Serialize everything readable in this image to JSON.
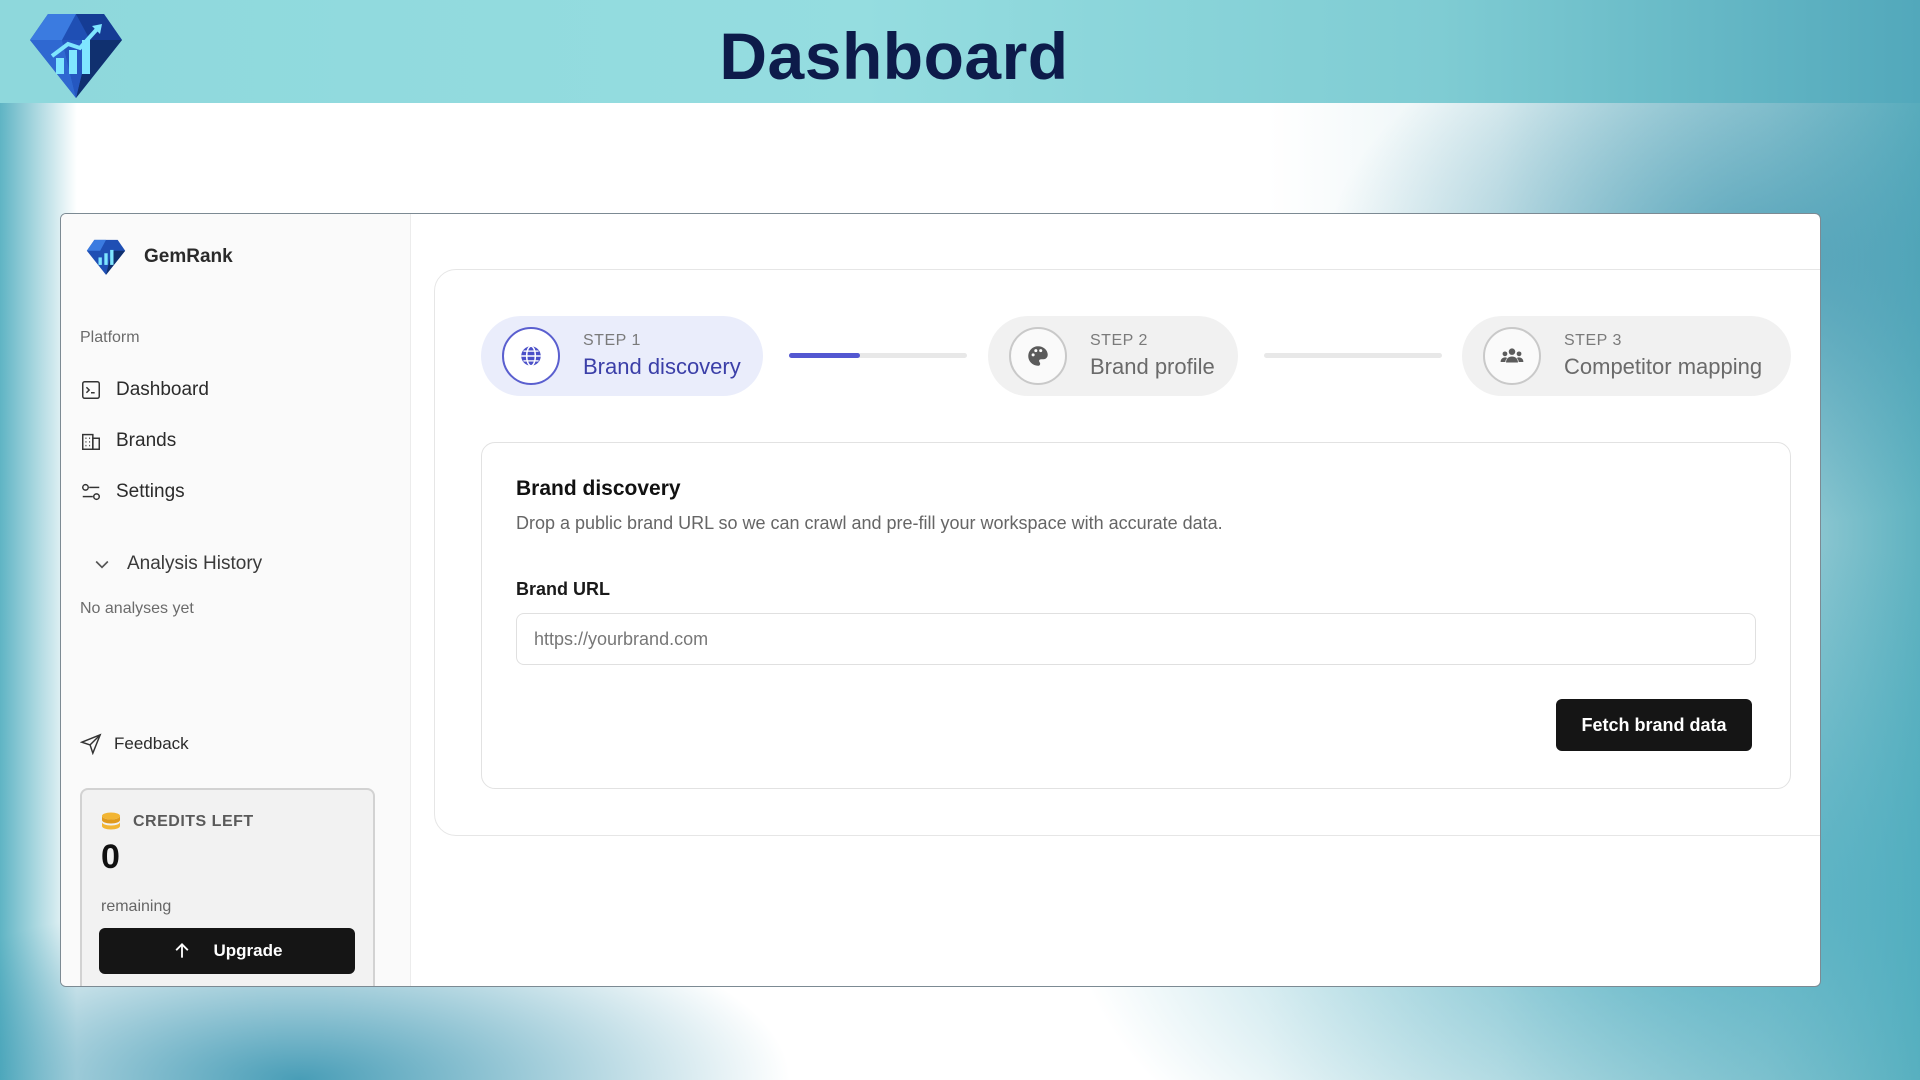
{
  "banner": {
    "title": "Dashboard"
  },
  "sidebar": {
    "brand_name": "GemRank",
    "section_label": "Platform",
    "items": [
      {
        "label": "Dashboard",
        "icon": "dashboard-icon"
      },
      {
        "label": "Brands",
        "icon": "building-icon"
      },
      {
        "label": "Settings",
        "icon": "sliders-icon"
      }
    ],
    "history": {
      "label": "Analysis History",
      "empty": "No analyses yet"
    },
    "feedback_label": "Feedback",
    "credits": {
      "label": "CREDITS LEFT",
      "value": "0",
      "sub": "remaining",
      "upgrade_label": "Upgrade"
    }
  },
  "stepper": {
    "steps": [
      {
        "num": "STEP 1",
        "title": "Brand discovery",
        "icon": "globe-icon",
        "active": true
      },
      {
        "num": "STEP 2",
        "title": "Brand profile",
        "icon": "palette-icon",
        "active": false
      },
      {
        "num": "STEP 3",
        "title": "Competitor mapping",
        "icon": "users-icon",
        "active": false
      }
    ],
    "progress": [
      0.4,
      0.0
    ]
  },
  "form": {
    "title": "Brand discovery",
    "description": "Drop a public brand URL so we can crawl and pre-fill your workspace with accurate data.",
    "url_label": "Brand URL",
    "url_value": "",
    "url_placeholder": "https://yourbrand.com",
    "submit_label": "Fetch brand data"
  },
  "colors": {
    "accent": "#5357d1",
    "active_step_bg": "#eaedfb",
    "button_bg": "#151515",
    "banner_title": "#0d1b4a"
  }
}
